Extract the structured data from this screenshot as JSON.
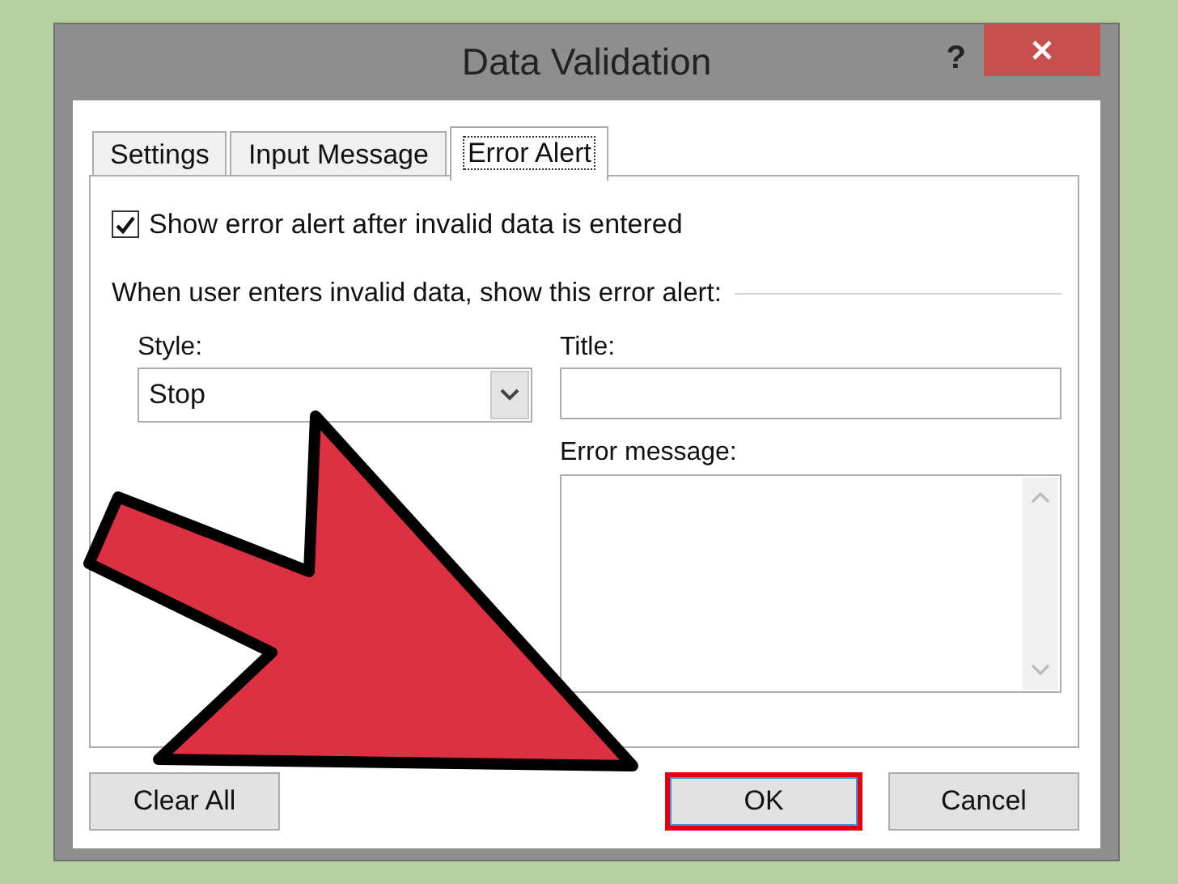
{
  "window": {
    "title": "Data Validation",
    "help": "?"
  },
  "tabs": [
    {
      "label": "Settings",
      "selected": false
    },
    {
      "label": "Input Message",
      "selected": false
    },
    {
      "label": "Error Alert",
      "selected": true
    }
  ],
  "show_alert": {
    "label": "Show error alert after invalid data is entered",
    "checked": true
  },
  "group_label": "When user enters invalid data, show this error alert:",
  "style": {
    "label": "Style:",
    "value": "Stop"
  },
  "title_field": {
    "label": "Title:"
  },
  "message_field": {
    "label": "Error message:"
  },
  "buttons": [
    {
      "label": "Clear All",
      "highlighted": false
    },
    {
      "label": "OK",
      "highlighted": true
    },
    {
      "label": "Cancel",
      "highlighted": false
    }
  ]
}
